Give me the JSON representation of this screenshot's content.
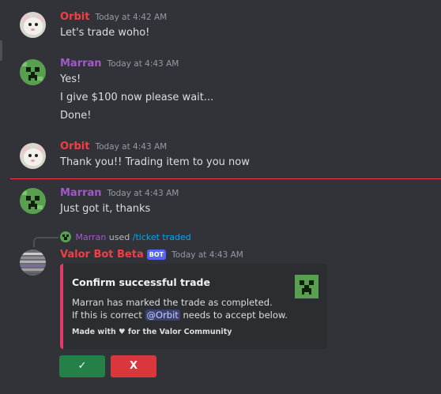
{
  "messages": [
    {
      "author": "Orbit",
      "time": "Today at 4:42 AM",
      "lines": [
        "Let's trade woho!"
      ]
    },
    {
      "author": "Marran",
      "time": "Today at 4:43 AM",
      "lines": [
        "Yes!",
        "I give $100 now please wait...",
        "Done!"
      ]
    },
    {
      "author": "Orbit",
      "time": "Today at 4:43 AM",
      "lines": [
        "Thank you!! Trading item to you now"
      ]
    },
    {
      "author": "Marran",
      "time": "Today at 4:43 AM",
      "lines": [
        "Just got it, thanks"
      ]
    }
  ],
  "reply": {
    "user": "Marran",
    "used": "used",
    "command": "/ticket traded"
  },
  "bot_message": {
    "author": "Valor Bot Beta",
    "tag": "BOT",
    "time": "Today at 4:43 AM",
    "embed": {
      "title": "Confirm successful trade",
      "desc_line1": "Marran has marked the trade as completed.",
      "desc_line2_pre": "If this is correct",
      "mention": "@Orbit",
      "desc_line2_post": "needs to accept below.",
      "footer": "Made with ♥ for the Valor Community",
      "accent_color": "#e03c6b"
    },
    "buttons": {
      "confirm": "✓",
      "deny": "X"
    }
  },
  "colors": {
    "orbit": "#f23f43",
    "marran": "#a259c9",
    "background": "#313338",
    "new_divider": "#f23f43"
  }
}
